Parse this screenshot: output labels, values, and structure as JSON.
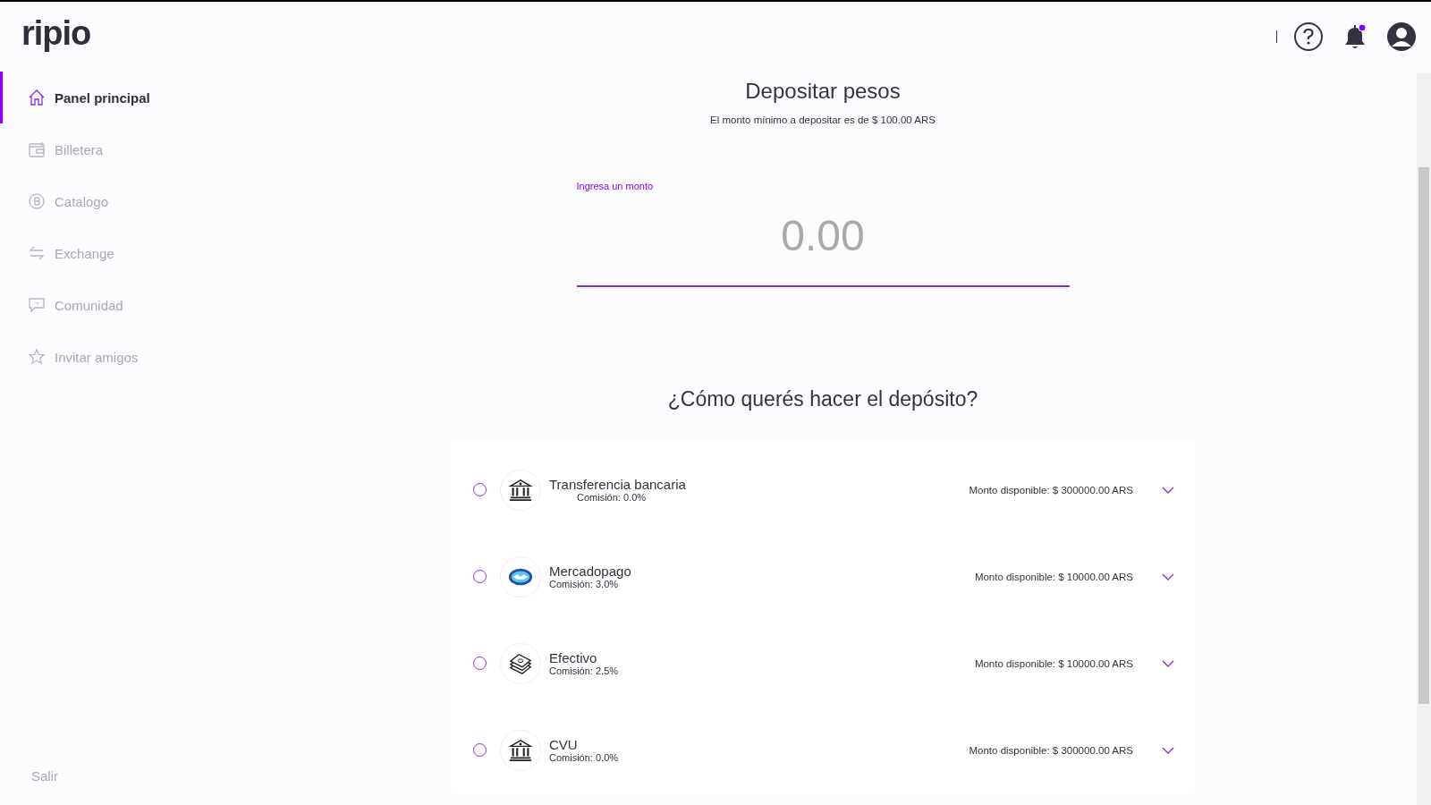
{
  "logo": "ripio",
  "nav": [
    {
      "label": "Panel principal",
      "kind": "home",
      "selected": true
    },
    {
      "label": "Billetera",
      "kind": "wallet",
      "selected": false
    },
    {
      "label": "Catalogo",
      "kind": "coin",
      "selected": false
    },
    {
      "label": "Exchange",
      "kind": "exchange",
      "selected": false
    },
    {
      "label": "Comunidad",
      "kind": "chat",
      "selected": false
    },
    {
      "label": "Invitar amigos",
      "kind": "star",
      "selected": false
    }
  ],
  "logout": "Salir",
  "header": {
    "notification_dot": true
  },
  "deposit": {
    "title": "Depositar pesos",
    "subtitle": "El monto mínimo a depositar es de $ 100.00 ARS",
    "amount_label": "Ingresa un monto",
    "amount_placeholder": "0.00"
  },
  "methods_title": "¿Cómo querés hacer el depósito?",
  "methods": [
    {
      "name": "Transferencia bancaria",
      "fee": "Comisión: 0.0%",
      "available": "Monto disponible: $ 300000.00 ARS",
      "kind": "bank",
      "selected": false
    },
    {
      "name": "Mercadopago",
      "fee": "Comisión: 3.0%",
      "available": "Monto disponible: $ 10000.00 ARS",
      "kind": "handshake",
      "selected": false
    },
    {
      "name": "Efectivo",
      "fee": "Comisión: 2.5%",
      "available": "Monto disponible: $ 10000.00 ARS",
      "kind": "cash",
      "selected": false
    },
    {
      "name": "CVU",
      "fee": "Comisión: 0.0%",
      "available": "Monto disponible: $ 300000.00 ARS",
      "kind": "bank",
      "selected": false
    }
  ]
}
